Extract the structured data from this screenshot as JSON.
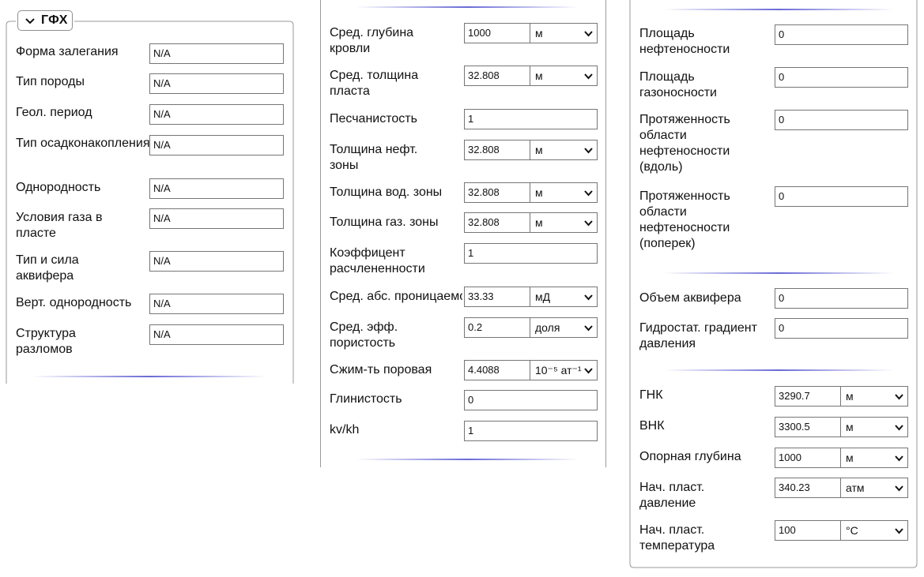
{
  "left": {
    "legend": "ГФХ",
    "rows": [
      {
        "label": "Форма залегания",
        "value": "N/A"
      },
      {
        "label": "Тип породы",
        "value": "N/A"
      },
      {
        "label": "Геол. период",
        "value": "N/A"
      },
      {
        "label": "Тип осадконакопления",
        "value": "N/A"
      },
      {
        "label": "Однородность",
        "value": "N/A"
      },
      {
        "label": "Условия газа в пласте",
        "value": "N/A"
      },
      {
        "label": "Тип и сила аквифера",
        "value": "N/A"
      },
      {
        "label": "Верт. однородность",
        "value": "N/A"
      },
      {
        "label": "Структура разломов",
        "value": "N/A"
      }
    ]
  },
  "middle": {
    "rows": [
      {
        "label": "Сред. глубина кровли",
        "value": "1000",
        "unit": "м"
      },
      {
        "label": "Сред. толщина пласта",
        "value": "32.808",
        "unit": "м"
      },
      {
        "label": "Песчанистость",
        "value": "1"
      },
      {
        "label": "Толщина нефт. зоны",
        "value": "32.808",
        "unit": "м"
      },
      {
        "label": "Толщина вод. зоны",
        "value": "32.808",
        "unit": "м"
      },
      {
        "label": "Толщина газ. зоны",
        "value": "32.808",
        "unit": "м"
      },
      {
        "label": "Коэффицент расчлененности",
        "value": "1"
      },
      {
        "label": "Сред. абс. проницаемость",
        "value": "33.33",
        "unit": "мД"
      },
      {
        "label": "Сред. эфф. пористость",
        "value": "0.2",
        "unit": "доля"
      },
      {
        "label": "Сжим-ть поровая",
        "value": "4.4088",
        "unit": "10⁻⁵ ат⁻¹"
      },
      {
        "label": "Глинистость",
        "value": "0"
      },
      {
        "label": "kv/kh",
        "value": "1"
      }
    ]
  },
  "right": {
    "rows_top": [
      {
        "label": "Площадь нефтеносности",
        "value": "0"
      },
      {
        "label": "Площадь газоносности",
        "value": "0"
      },
      {
        "label": "Протяженность области нефтеносности (вдоль)",
        "value": "0"
      },
      {
        "label": "Протяженность области нефтеносности (поперек)",
        "value": "0"
      }
    ],
    "rows_mid": [
      {
        "label": "Объем аквифера",
        "value": "0"
      },
      {
        "label": "Гидростат. градиент давления",
        "value": "0"
      }
    ],
    "rows_bottom": [
      {
        "label": "ГНК",
        "value": "3290.7",
        "unit": "м"
      },
      {
        "label": "ВНК",
        "value": "3300.5",
        "unit": "м"
      },
      {
        "label": "Опорная глубина",
        "value": "1000",
        "unit": "м"
      },
      {
        "label": "Нач. пласт. давление",
        "value": "340.23",
        "unit": "атм"
      },
      {
        "label": "Нач. пласт. температура",
        "value": "100",
        "unit": "°C"
      }
    ]
  }
}
